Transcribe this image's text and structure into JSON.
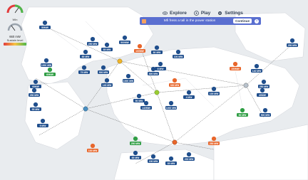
{
  "nav": {
    "explore_label": "Explore",
    "play_label": "Play",
    "settings_label": "Settings"
  },
  "banner": {
    "text": "Mfi fress a tall in the power station",
    "button_label": "Continue",
    "help_label": "?"
  },
  "hud": {
    "gauge1_label": "Win",
    "gauge2_value": "660 mW",
    "bar_label": "Sustain level"
  },
  "colors": {
    "water": "#e9ecef",
    "land": "#ffffff",
    "badge_blue": "#1f4e8c",
    "badge_green": "#2f9e44",
    "badge_orange": "#e8662b",
    "hub_gold": "#f0b429",
    "banner": "#5a6fd0"
  },
  "map_labels": [
    "50MW",
    "250 MW",
    "85 MW",
    "500MW",
    "100MW",
    "85 MW",
    "75 MW",
    "500 MW",
    "80 MW",
    "100 MW",
    "60MW",
    "95MW",
    "250 MW",
    "55 MW",
    "9 MW",
    "140 MW",
    "1000 MW",
    "800 MW",
    "8 MW",
    "330 MW",
    "50 MW",
    "140MW",
    "1000 MW",
    "4 MW",
    "150MW",
    "140 MW",
    "250 MW",
    "40MW",
    "500 MW",
    "50 MW",
    "100 MW",
    "250 MW",
    "85 MW",
    "150 MW",
    "35 MW",
    "200 MW",
    "250 MW",
    "100 MW",
    "1000 MW",
    "250 MW"
  ]
}
